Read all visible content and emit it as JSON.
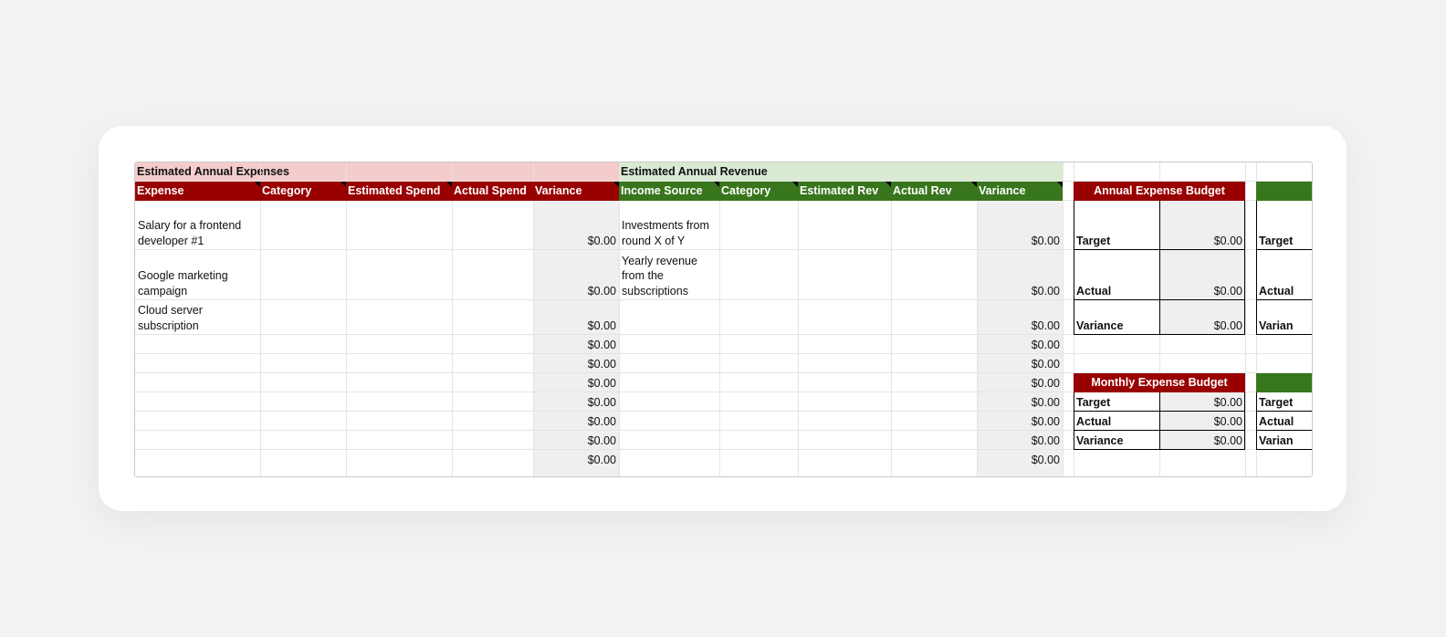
{
  "colors": {
    "expense_header_red": "#990000",
    "expense_section_pink": "#f4cccc",
    "revenue_header_green": "#38761d",
    "revenue_section_green": "#d9ead3",
    "variance_gray": "#efefef"
  },
  "expenses": {
    "title": "Estimated Annual Expenses",
    "headers": [
      "Expense",
      "Category",
      "Estimated Spend",
      "Actual Spend",
      "Variance"
    ],
    "rows": [
      {
        "expense": "Salary for a frontend developer #1",
        "variance": "$0.00"
      },
      {
        "expense": "Google marketing campaign",
        "variance": "$0.00"
      },
      {
        "expense": "Cloud server subscription",
        "variance": "$0.00"
      },
      {
        "expense": "",
        "variance": "$0.00"
      },
      {
        "expense": "",
        "variance": "$0.00"
      },
      {
        "expense": "",
        "variance": "$0.00"
      },
      {
        "expense": "",
        "variance": "$0.00"
      },
      {
        "expense": "",
        "variance": "$0.00"
      },
      {
        "expense": "",
        "variance": "$0.00"
      },
      {
        "expense": "",
        "variance": "$0.00"
      }
    ]
  },
  "revenue": {
    "title": "Estimated Annual Revenue",
    "headers": [
      "Income Source",
      "Category",
      "Estimated Rev",
      "Actual Rev",
      "Variance"
    ],
    "rows": [
      {
        "source": "Investments from round X of Y",
        "variance": "$0.00"
      },
      {
        "source": "Yearly revenue from the subscriptions",
        "variance": "$0.00"
      },
      {
        "source": "",
        "variance": "$0.00"
      },
      {
        "source": "",
        "variance": "$0.00"
      },
      {
        "source": "",
        "variance": "$0.00"
      },
      {
        "source": "",
        "variance": "$0.00"
      },
      {
        "source": "",
        "variance": "$0.00"
      },
      {
        "source": "",
        "variance": "$0.00"
      },
      {
        "source": "",
        "variance": "$0.00"
      },
      {
        "source": "",
        "variance": "$0.00"
      }
    ]
  },
  "annual_expense_budget": {
    "title": "Annual Expense Budget",
    "target_label": "Target",
    "target_value": "$0.00",
    "actual_label": "Actual",
    "actual_value": "$0.00",
    "variance_label": "Variance",
    "variance_value": "$0.00"
  },
  "monthly_expense_budget": {
    "title": "Monthly Expense Budget",
    "target_label": "Target",
    "target_value": "$0.00",
    "actual_label": "Actual",
    "actual_value": "$0.00",
    "variance_label": "Variance",
    "variance_value": "$0.00"
  },
  "revenue_budget_partial": {
    "target_label": "Target",
    "actual_label": "Actual",
    "variance_label": "Varian"
  }
}
